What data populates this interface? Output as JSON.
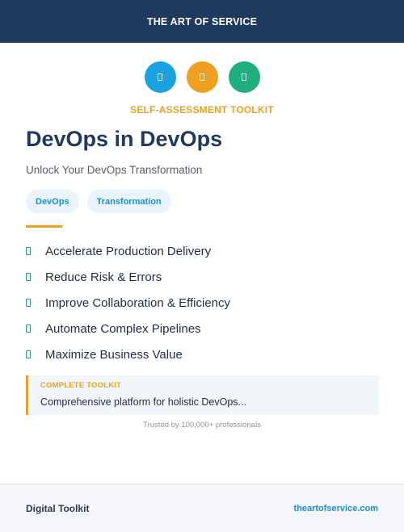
{
  "header": {
    "brand": "THE ART OF SERVICE",
    "bg_color": "#1e3a5f"
  },
  "icons": [
    {
      "name": "document-icon",
      "color": "#1aa3e0"
    },
    {
      "name": "document-icon",
      "color": "#f0a01f"
    },
    {
      "name": "document-icon",
      "color": "#1fae7e"
    }
  ],
  "hero": {
    "kicker": "SELF-ASSESSMENT TOOLKIT",
    "title": "DevOps in DevOps",
    "subtitle": "Unlock Your DevOps Transformation"
  },
  "tags": [
    "DevOps",
    "Transformation"
  ],
  "features": [
    "Accelerate Production Delivery",
    "Reduce Risk & Errors",
    "Improve Collaboration & Efficiency",
    "Automate Complex Pipelines",
    "Maximize Business Value"
  ],
  "callout": {
    "label": "COMPLETE TOOLKIT",
    "text": "Comprehensive platform for holistic DevOps..."
  },
  "trust_text": "Trusted by 100,000+ professionals",
  "footer": {
    "left": "Digital Toolkit",
    "right": "theartofservice.com"
  },
  "colors": {
    "accent_orange": "#f0a01f",
    "accent_blue": "#1a8fd6",
    "accent_green": "#16a878"
  }
}
